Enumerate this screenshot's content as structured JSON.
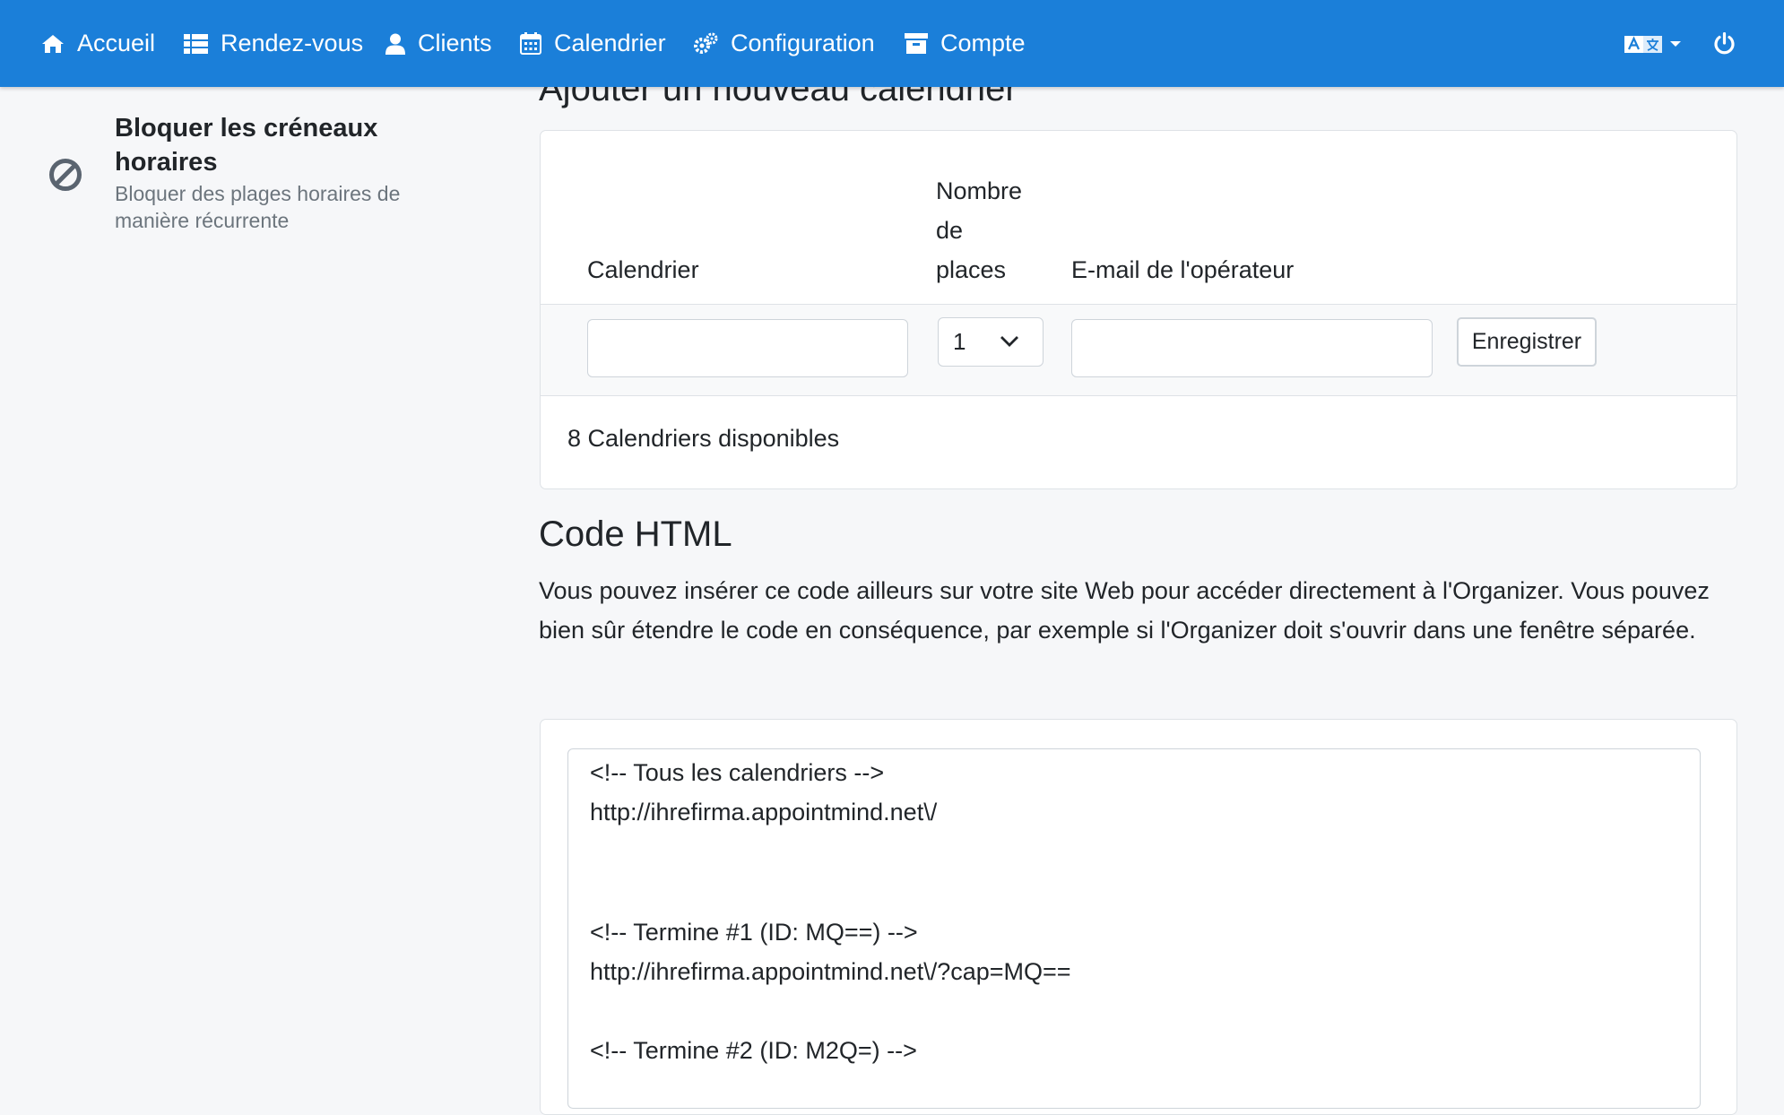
{
  "nav": {
    "items": [
      {
        "label": "Accueil",
        "icon": "home-icon"
      },
      {
        "label": "Rendez-vous",
        "icon": "list-icon"
      },
      {
        "label": "Clients",
        "icon": "user-icon"
      },
      {
        "label": "Calendrier",
        "icon": "calendar-icon"
      },
      {
        "label": "Configuration",
        "icon": "gears-icon"
      },
      {
        "label": "Compte",
        "icon": "archive-icon"
      }
    ],
    "language_icon": "translate-icon",
    "power_icon": "power-icon",
    "color": "#1b7fd9"
  },
  "sidebar": {
    "title": "Bloquer les créneaux horaires",
    "description": "Bloquer des plages horaires de manière récurrente",
    "icon": "ban-icon"
  },
  "add_calendar": {
    "heading": "Ajouter un nouveau calendrier",
    "col_calendar": "Calendrier",
    "col_places_line1": "Nombre",
    "col_places_line2": "de",
    "col_places_line3": "places",
    "col_email": "E-mail de l'opérateur",
    "calendar_value": "",
    "places_value": "1",
    "email_value": "",
    "save_label": "Enregistrer",
    "footer": "8 Calendriers disponibles"
  },
  "code_html": {
    "heading": "Code HTML",
    "description": "Vous pouvez insérer ce code ailleurs sur votre site Web pour accéder directement à l'Organizer. Vous pouvez bien sûr étendre le code en conséquence, par exemple si l'Organizer doit s'ouvrir dans une fenêtre séparée.",
    "lines": [
      "<!-- Tous les calendriers -->",
      "http://ihrefirma.appointmind.net\\/",
      "<!-- Termine #1 (ID: MQ==) -->",
      "http://ihrefirma.appointmind.net\\/?cap=MQ==",
      "<!-- Termine #2 (ID: M2Q=) -->"
    ]
  }
}
